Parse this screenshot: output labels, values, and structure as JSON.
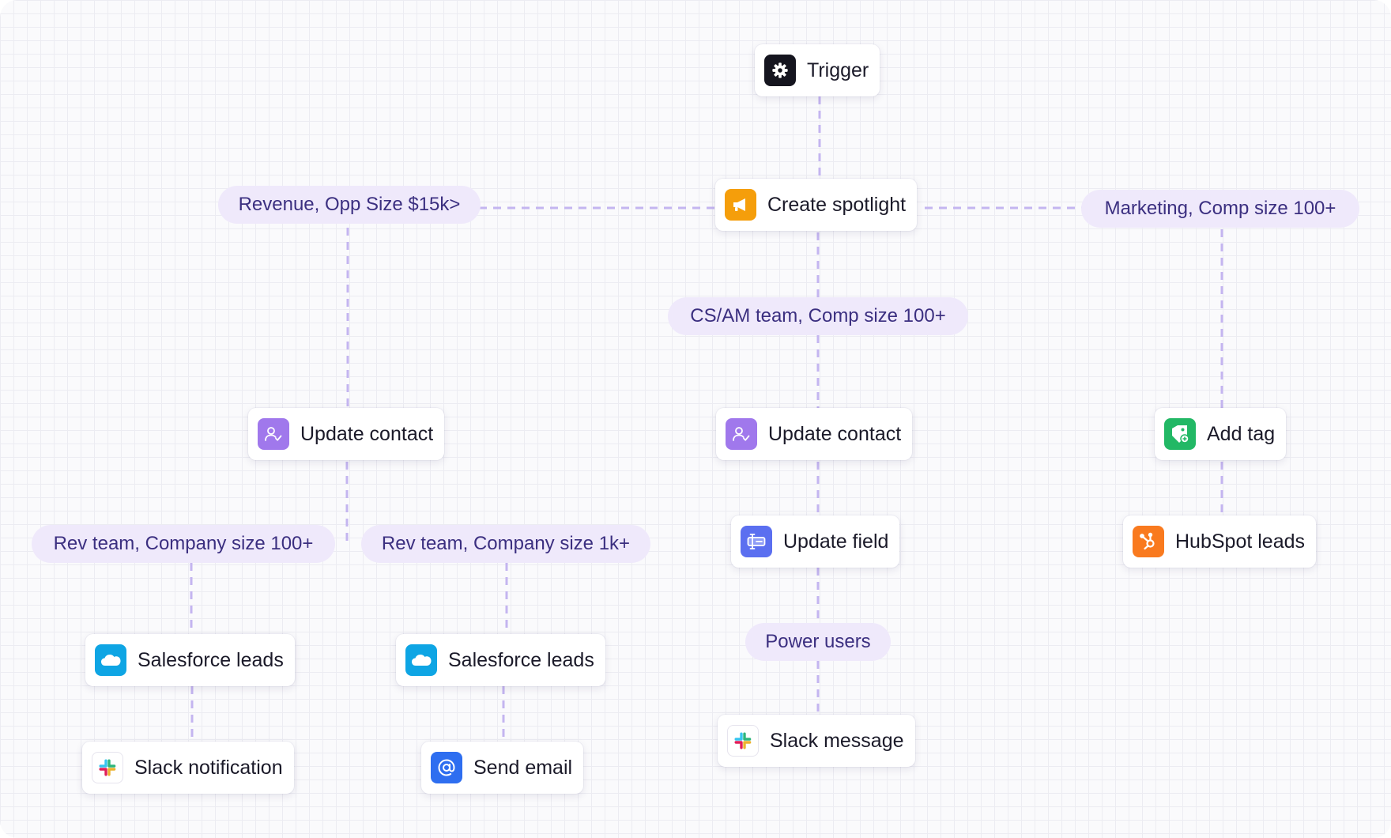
{
  "nodes": {
    "trigger": {
      "label": "Trigger",
      "icon": "gear-icon",
      "color": "#15151f"
    },
    "create_spotlight": {
      "label": "Create spotlight",
      "icon": "megaphone-icon",
      "color": "#f59e0b"
    },
    "update_contact_left": {
      "label": "Update contact",
      "icon": "user-check-icon",
      "color": "#a078ec"
    },
    "update_contact_mid": {
      "label": "Update contact",
      "icon": "user-check-icon",
      "color": "#a078ec"
    },
    "add_tag": {
      "label": "Add tag",
      "icon": "tag-icon",
      "color": "#22b865"
    },
    "update_field": {
      "label": "Update field",
      "icon": "text-field-icon",
      "color": "#5b6ff0"
    },
    "hubspot_leads": {
      "label": "HubSpot leads",
      "icon": "hubspot-icon",
      "color": "#f97a1f"
    },
    "salesforce_leads_1": {
      "label": "Salesforce leads",
      "icon": "salesforce-cloud-icon",
      "color": "#0ea5e4"
    },
    "salesforce_leads_2": {
      "label": "Salesforce leads",
      "icon": "salesforce-cloud-icon",
      "color": "#0ea5e4"
    },
    "slack_notification": {
      "label": "Slack notification",
      "icon": "slack-icon",
      "color": "#ffffff"
    },
    "send_email": {
      "label": "Send email",
      "icon": "at-sign-icon",
      "color": "#2e6ef0"
    },
    "slack_message": {
      "label": "Slack message",
      "icon": "slack-icon",
      "color": "#ffffff"
    }
  },
  "conditions": {
    "revenue": "Revenue, Opp Size $15k>",
    "marketing": "Marketing, Comp size 100+",
    "cs_am": "CS/AM team, Comp size 100+",
    "rev_100": "Rev team, Company size 100+",
    "rev_1k": "Rev team, Company size 1k+",
    "power_users": "Power users"
  },
  "colors": {
    "connector": "#c4b5f0",
    "pill_bg": "#efe9fb",
    "pill_text": "#3b2f80"
  }
}
